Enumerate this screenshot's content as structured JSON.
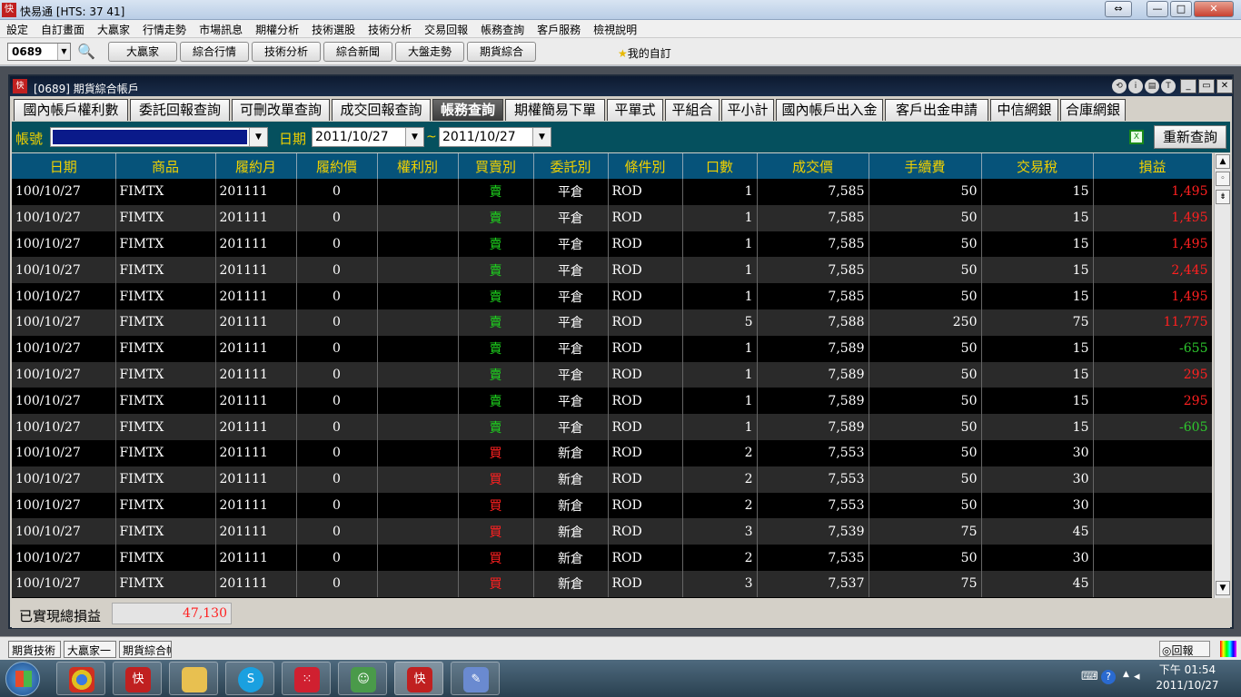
{
  "app": {
    "title": "快易通  [HTS: 37 41]"
  },
  "menu": [
    "設定",
    "自訂畫面",
    "大贏家",
    "行情走勢",
    "市場訊息",
    "期權分析",
    "技術選股",
    "技術分析",
    "交易回報",
    "帳務查詢",
    "客戶服務",
    "檢視說明"
  ],
  "toolbar": {
    "code": "0689",
    "buttons": [
      "大贏家",
      "綜合行情",
      "技術分析",
      "綜合新聞",
      "大盤走勢",
      "期貨綜合"
    ],
    "favorite": "我的自訂"
  },
  "child": {
    "title": "[0689] 期貨綜合帳戶"
  },
  "tabs": [
    "國內帳戶權利數",
    "委託回報查詢",
    "可刪改單查詢",
    "成交回報查詢",
    "帳務查詢",
    "期權簡易下單",
    "平單式",
    "平組合",
    "平小計",
    "國內帳戶出入金",
    "客戶出金申請",
    "中信網銀",
    "合庫網銀"
  ],
  "active_tab": "帳務查詢",
  "filter": {
    "account_label": "帳號",
    "date_label": "日期",
    "date_from": "2011/10/27",
    "tilde": "~",
    "date_to": "2011/10/27",
    "query_button": "重新查詢"
  },
  "table": {
    "headers": [
      "日期",
      "商品",
      "履約月",
      "履約價",
      "權利別",
      "買賣別",
      "委託別",
      "條件別",
      "口數",
      "成交價",
      "手續費",
      "交易稅",
      "損益"
    ],
    "rows": [
      [
        "100/10/27",
        "FIMTX",
        "201111",
        "0",
        "",
        "賣",
        "平倉",
        "ROD",
        "1",
        "7,585",
        "50",
        "15",
        "1,495"
      ],
      [
        "100/10/27",
        "FIMTX",
        "201111",
        "0",
        "",
        "賣",
        "平倉",
        "ROD",
        "1",
        "7,585",
        "50",
        "15",
        "1,495"
      ],
      [
        "100/10/27",
        "FIMTX",
        "201111",
        "0",
        "",
        "賣",
        "平倉",
        "ROD",
        "1",
        "7,585",
        "50",
        "15",
        "1,495"
      ],
      [
        "100/10/27",
        "FIMTX",
        "201111",
        "0",
        "",
        "賣",
        "平倉",
        "ROD",
        "1",
        "7,585",
        "50",
        "15",
        "2,445"
      ],
      [
        "100/10/27",
        "FIMTX",
        "201111",
        "0",
        "",
        "賣",
        "平倉",
        "ROD",
        "1",
        "7,585",
        "50",
        "15",
        "1,495"
      ],
      [
        "100/10/27",
        "FIMTX",
        "201111",
        "0",
        "",
        "賣",
        "平倉",
        "ROD",
        "5",
        "7,588",
        "250",
        "75",
        "11,775"
      ],
      [
        "100/10/27",
        "FIMTX",
        "201111",
        "0",
        "",
        "賣",
        "平倉",
        "ROD",
        "1",
        "7,589",
        "50",
        "15",
        "-655"
      ],
      [
        "100/10/27",
        "FIMTX",
        "201111",
        "0",
        "",
        "賣",
        "平倉",
        "ROD",
        "1",
        "7,589",
        "50",
        "15",
        "295"
      ],
      [
        "100/10/27",
        "FIMTX",
        "201111",
        "0",
        "",
        "賣",
        "平倉",
        "ROD",
        "1",
        "7,589",
        "50",
        "15",
        "295"
      ],
      [
        "100/10/27",
        "FIMTX",
        "201111",
        "0",
        "",
        "賣",
        "平倉",
        "ROD",
        "1",
        "7,589",
        "50",
        "15",
        "-605"
      ],
      [
        "100/10/27",
        "FIMTX",
        "201111",
        "0",
        "",
        "買",
        "新倉",
        "ROD",
        "2",
        "7,553",
        "50",
        "30",
        ""
      ],
      [
        "100/10/27",
        "FIMTX",
        "201111",
        "0",
        "",
        "買",
        "新倉",
        "ROD",
        "2",
        "7,553",
        "50",
        "30",
        ""
      ],
      [
        "100/10/27",
        "FIMTX",
        "201111",
        "0",
        "",
        "買",
        "新倉",
        "ROD",
        "2",
        "7,553",
        "50",
        "30",
        ""
      ],
      [
        "100/10/27",
        "FIMTX",
        "201111",
        "0",
        "",
        "買",
        "新倉",
        "ROD",
        "3",
        "7,539",
        "75",
        "45",
        ""
      ],
      [
        "100/10/27",
        "FIMTX",
        "201111",
        "0",
        "",
        "買",
        "新倉",
        "ROD",
        "2",
        "7,535",
        "50",
        "30",
        ""
      ],
      [
        "100/10/27",
        "FIMTX",
        "201111",
        "0",
        "",
        "買",
        "新倉",
        "ROD",
        "3",
        "7,537",
        "75",
        "45",
        ""
      ]
    ]
  },
  "total": {
    "label": "已實現總損益",
    "value": "47,130"
  },
  "window_tabs": [
    "期貨技術",
    "大贏家一",
    "期貨綜合帳戶"
  ],
  "status_right": {
    "report": "回報"
  },
  "clock": {
    "time": "下午 01:54",
    "date": "2011/10/27"
  },
  "colors": {
    "header_bg": "#06537a",
    "header_text": "#f0d000",
    "sell": "#1ed71e",
    "buy": "#ff2020",
    "profit": "#ff2020",
    "loss": "#2ec82e",
    "filter_bg": "#05505e"
  },
  "icons": [
    "search-icon",
    "star-icon",
    "excel-icon",
    "scroll-up-icon",
    "scroll-down-icon",
    "windows-start-icon",
    "chrome-icon",
    "folder-icon",
    "skype-icon"
  ]
}
